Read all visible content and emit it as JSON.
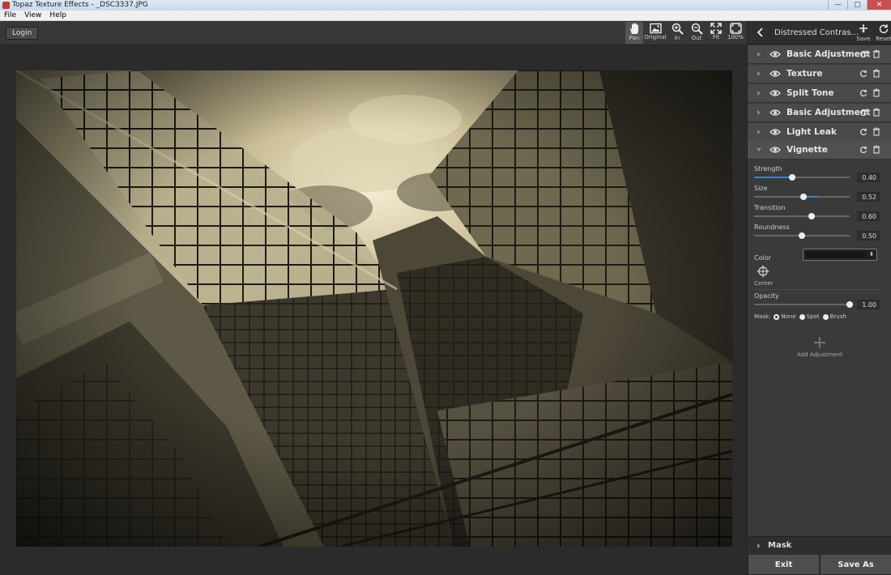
{
  "window": {
    "title": "Topaz Texture Effects - _DSC3337.JPG",
    "controls": [
      "—",
      "▢",
      "✕"
    ]
  },
  "menu": [
    "File",
    "View",
    "Help"
  ],
  "toolbar": {
    "login_label": "Login",
    "tools": [
      {
        "label": "Pan",
        "icon": "hand-icon",
        "active": true
      },
      {
        "label": "Original",
        "icon": "image-icon",
        "active": false
      },
      {
        "label": "In",
        "icon": "zoom-in-icon",
        "active": false
      },
      {
        "label": "Out",
        "icon": "zoom-out-icon",
        "active": false
      },
      {
        "label": "Fit",
        "icon": "fit-icon",
        "active": false
      },
      {
        "label": "100%",
        "icon": "actual-size-icon",
        "active": false
      }
    ]
  },
  "panel": {
    "preset_name": "Distressed Contras... *",
    "save_label": "Save",
    "reset_label": "Reset",
    "adjustments": [
      {
        "label": "Basic Adjustment",
        "expanded": false
      },
      {
        "label": "Texture",
        "expanded": false
      },
      {
        "label": "Split Tone",
        "expanded": false
      },
      {
        "label": "Basic Adjustment",
        "expanded": false
      },
      {
        "label": "Light Leak",
        "expanded": false
      },
      {
        "label": "Vignette",
        "expanded": true
      }
    ],
    "vignette": {
      "sliders": [
        {
          "label": "Strength",
          "value": "0.40",
          "level": 0.4,
          "fill": "left"
        },
        {
          "label": "Size",
          "value": "0.52",
          "level": 0.52,
          "fill": "center"
        },
        {
          "label": "Transition",
          "value": "0.60",
          "level": 0.6,
          "fill": "none"
        },
        {
          "label": "Roundness",
          "value": "0.50",
          "level": 0.5,
          "fill": "none"
        }
      ],
      "color_label": "Color",
      "color_value": "#161616",
      "center_label": "Center",
      "opacity": {
        "label": "Opacity",
        "value": "1.00",
        "level": 1.0
      },
      "mask_label": "Mask:",
      "mask_options": [
        {
          "label": "None",
          "checked": true
        },
        {
          "label": "Spot",
          "checked": false
        },
        {
          "label": "Brush",
          "checked": false
        }
      ]
    },
    "add_adjustment_label": "Add Adjustment",
    "mask_section_label": "Mask",
    "exit_label": "Exit",
    "save_as_label": "Save As"
  },
  "colors": {
    "accent": "#3d86c6",
    "panel_bg": "#3a3a3a",
    "row_bg": "#4a4a4a"
  }
}
